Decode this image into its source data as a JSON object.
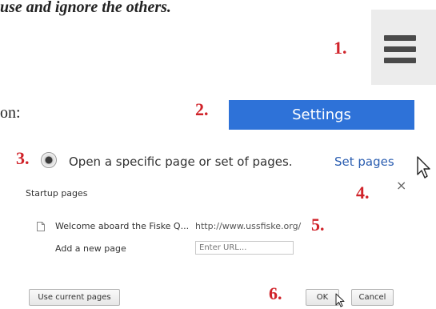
{
  "instruction_text": "use and ignore the others.",
  "option_text": "on:",
  "steps": {
    "s1": "1.",
    "s2": "2.",
    "s3": "3.",
    "s4": "4.",
    "s5": "5.",
    "s6": "6."
  },
  "settings_label": "Settings",
  "radio_option_label": "Open a specific page or set of pages.",
  "set_pages_link": "Set pages",
  "dialog": {
    "title": "Startup pages",
    "close_glyph": "×",
    "page_title": "Welcome aboard the Fiske Q...",
    "page_url": "http://www.ussfiske.org/",
    "add_label": "Add a new page",
    "url_placeholder": "Enter URL...",
    "use_current_label": "Use current pages",
    "ok_label": "OK",
    "cancel_label": "Cancel"
  },
  "colors": {
    "accent": "#2e72d8",
    "step": "#d0232a",
    "link": "#2a5db0"
  },
  "icons": [
    "hamburger-menu-icon",
    "cursor-arrow-icon",
    "page-icon",
    "close-icon"
  ]
}
